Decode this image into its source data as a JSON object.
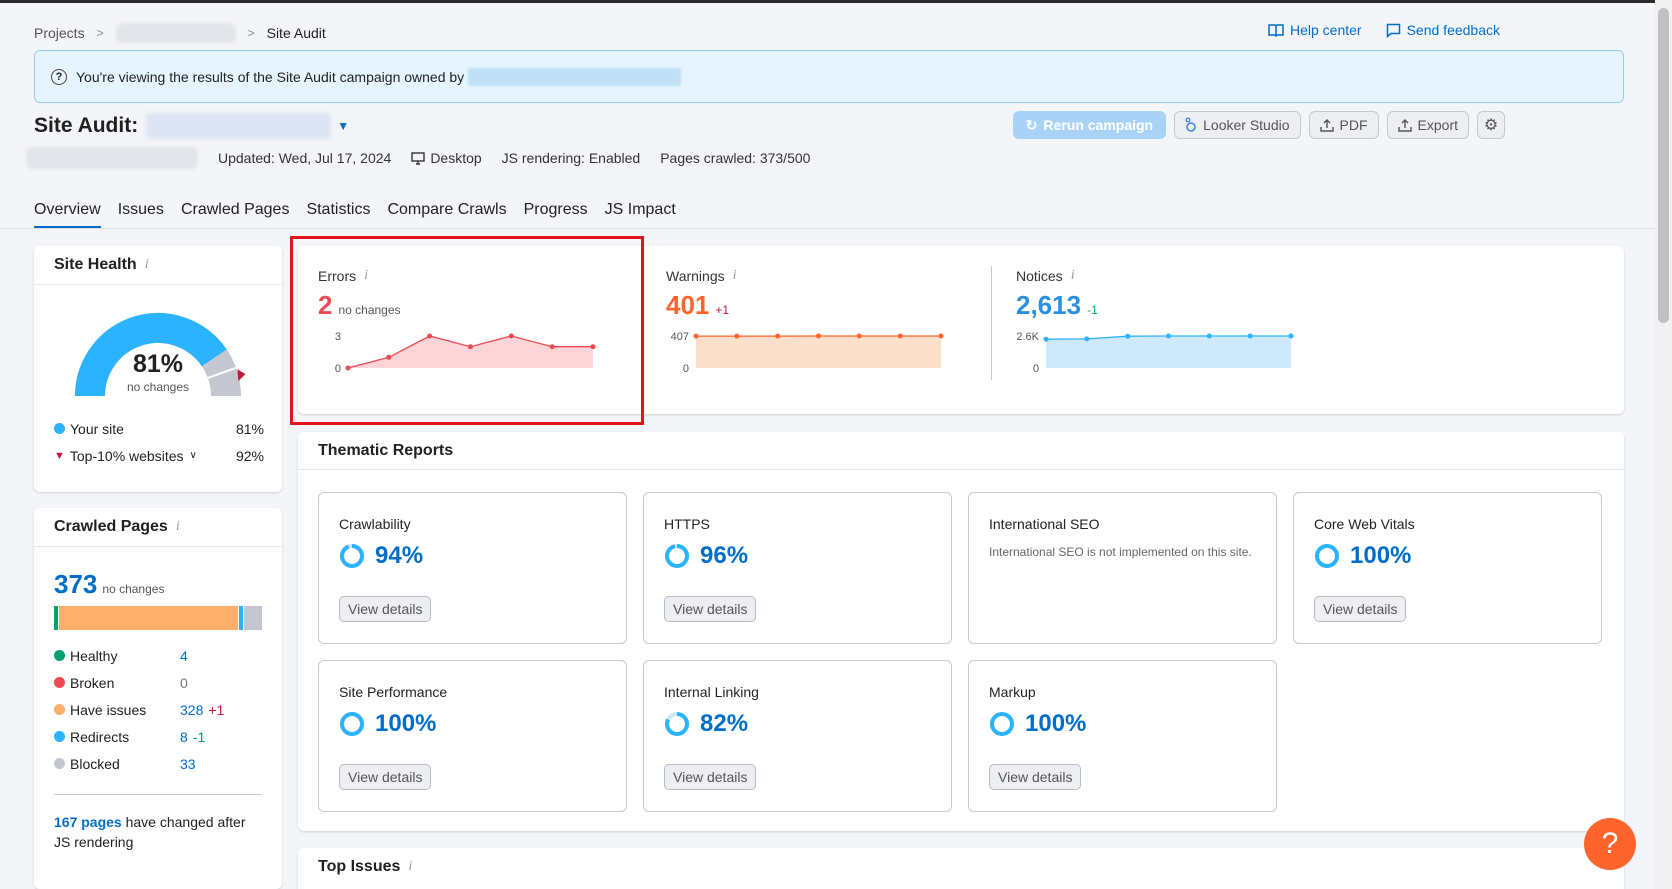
{
  "breadcrumb": {
    "projects": "Projects",
    "current": "Site Audit"
  },
  "toplinks": {
    "help": "Help center",
    "feedback": "Send feedback"
  },
  "banner": {
    "text": "You're viewing the results of the Site Audit campaign owned by"
  },
  "title": "Site Audit:",
  "actions": {
    "rerun": "Rerun campaign",
    "looker": "Looker Studio",
    "pdf": "PDF",
    "export": "Export"
  },
  "meta": {
    "updated": "Updated: Wed, Jul 17, 2024",
    "device": "Desktop",
    "js": "JS rendering: Enabled",
    "pages": "Pages crawled: 373/500"
  },
  "tabs": [
    "Overview",
    "Issues",
    "Crawled Pages",
    "Statistics",
    "Compare Crawls",
    "Progress",
    "JS Impact"
  ],
  "site_health": {
    "title": "Site Health",
    "value": "81%",
    "change": "no changes",
    "your_site_label": "Your site",
    "your_site_value": "81%",
    "top10_label": "Top-10% websites",
    "top10_value": "92%",
    "gauge_fraction": 0.81
  },
  "crawled_pages": {
    "title": "Crawled Pages",
    "value": "373",
    "change": "no changes",
    "rows": [
      {
        "label": "Healthy",
        "value": "4",
        "delta": "",
        "color": "#00a170"
      },
      {
        "label": "Broken",
        "value": "0",
        "delta": "",
        "color": "#ef4a53"
      },
      {
        "label": "Have issues",
        "value": "328",
        "delta": "+1",
        "color": "#ffae6c"
      },
      {
        "label": "Redirects",
        "value": "8",
        "delta": "-1",
        "color": "#2bb3ff"
      },
      {
        "label": "Blocked",
        "value": "33",
        "delta": "",
        "color": "#c4c7cf"
      }
    ],
    "js_link": "167 pages",
    "js_text": "have changed after JS rendering"
  },
  "errors": {
    "label": "Errors",
    "value": "2",
    "change": "no changes",
    "ymax": "3",
    "ymin": "0",
    "color": "#ef4a53"
  },
  "warnings": {
    "label": "Warnings",
    "value": "401",
    "change": "+1",
    "ymax": "407",
    "ymin": "0",
    "color": "#ff642d"
  },
  "notices": {
    "label": "Notices",
    "value": "2,613",
    "change": "-1",
    "ymax": "2.6K",
    "ymin": "0",
    "color": "#2bb3ff"
  },
  "chart_data": [
    {
      "type": "area",
      "title": "Errors",
      "values": [
        0,
        1,
        3,
        2,
        3,
        2,
        2
      ],
      "ylim": [
        0,
        3
      ]
    },
    {
      "type": "area",
      "title": "Warnings",
      "values": [
        406,
        406,
        406,
        407,
        407,
        407,
        407
      ],
      "ylim": [
        0,
        407
      ]
    },
    {
      "type": "area",
      "title": "Notices",
      "values": [
        2350,
        2380,
        2600,
        2610,
        2612,
        2613,
        2613
      ],
      "ylim": [
        0,
        2613
      ]
    }
  ],
  "thematic": {
    "title": "Thematic Reports",
    "view_details": "View details",
    "cards": [
      {
        "name": "Crawlability",
        "pct": "94%",
        "fraction": 0.94
      },
      {
        "name": "HTTPS",
        "pct": "96%",
        "fraction": 0.96
      },
      {
        "name": "International SEO",
        "desc": "International SEO is not implemented on this site."
      },
      {
        "name": "Core Web Vitals",
        "pct": "100%",
        "fraction": 1.0
      },
      {
        "name": "Site Performance",
        "pct": "100%",
        "fraction": 1.0
      },
      {
        "name": "Internal Linking",
        "pct": "82%",
        "fraction": 0.82
      },
      {
        "name": "Markup",
        "pct": "100%",
        "fraction": 1.0
      }
    ]
  },
  "top_issues": {
    "title": "Top Issues"
  },
  "fab": "?"
}
